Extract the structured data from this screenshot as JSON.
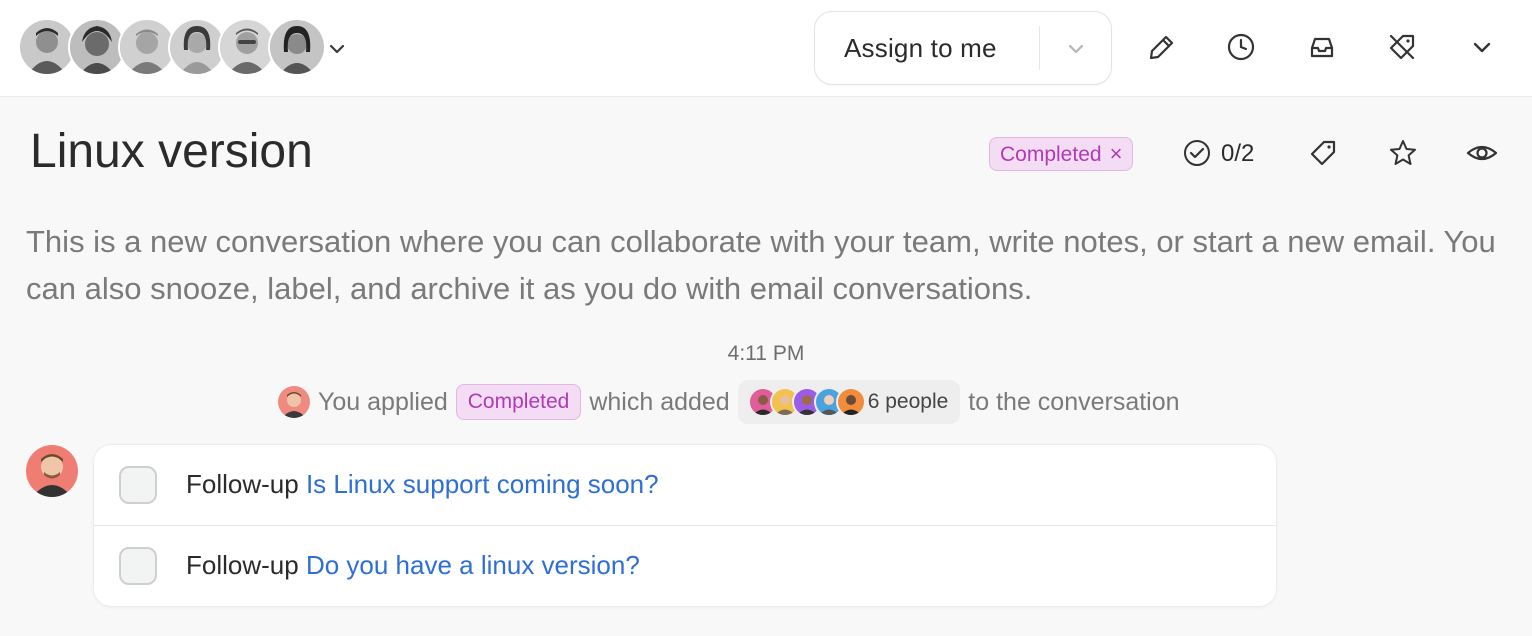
{
  "topbar": {
    "members": [
      "member-1",
      "member-2",
      "member-3",
      "member-4",
      "member-5",
      "member-6"
    ],
    "assign_label": "Assign to me",
    "icons": [
      "pencil-icon",
      "clock-icon",
      "inbox-icon",
      "no-tag-icon",
      "chevron-down-icon"
    ]
  },
  "conversation": {
    "title": "Linux version",
    "tag": {
      "label": "Completed",
      "remove": "×",
      "color": "#b13bb5",
      "background": "#f4dcf4"
    },
    "checklist_count": "0/2",
    "description": "This is a new conversation where you can collaborate with your team, write notes, or start a new email. You can also snooze, label, and archive it as you do with email conversations."
  },
  "activity": {
    "time": "4:11 PM",
    "event": {
      "prefix": "You applied",
      "tag": "Completed",
      "middle": "which added",
      "people": "6 people",
      "suffix": "to the conversation"
    }
  },
  "followups": [
    {
      "prefix": "Follow-up",
      "link": "Is Linux support coming soon?",
      "checked": false
    },
    {
      "prefix": "Follow-up",
      "link": "Do you have a linux version?",
      "checked": false
    }
  ],
  "colors": {
    "link": "#2d6fd6",
    "tag_text": "#b13bb5",
    "tag_bg": "#f4dcf4",
    "muted_text": "#7a7a7a"
  }
}
